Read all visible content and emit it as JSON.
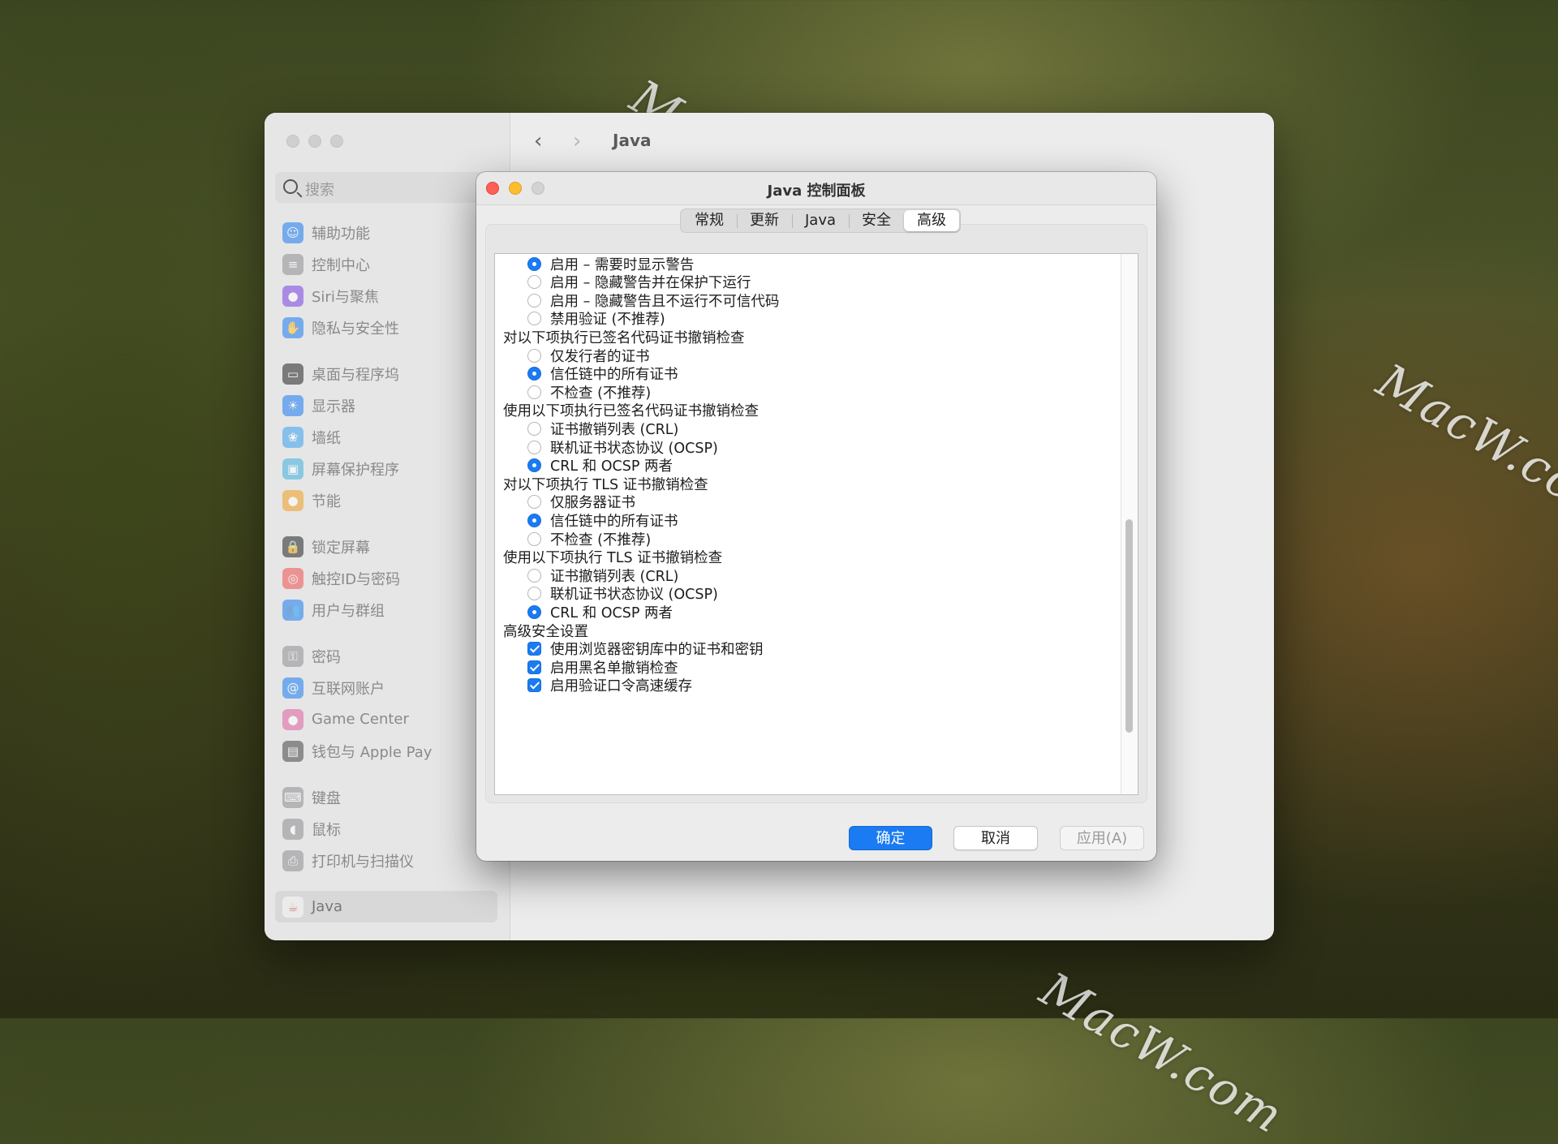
{
  "watermark": "MacW.com",
  "settings": {
    "title": "Java",
    "search_placeholder": "搜索",
    "sidebar": {
      "groups": [
        [
          {
            "label": "辅助功能",
            "icon": "accessibility-icon",
            "color": "#1a7bf2",
            "glyph": "☺"
          },
          {
            "label": "控制中心",
            "icon": "control-center-icon",
            "color": "#8e8e93",
            "glyph": "≡"
          },
          {
            "label": "Siri与聚焦",
            "icon": "siri-icon",
            "color": "#7b3fe4",
            "glyph": "●"
          },
          {
            "label": "隐私与安全性",
            "icon": "hand-icon",
            "color": "#1a7bf2",
            "glyph": "✋"
          }
        ],
        [
          {
            "label": "桌面与程序坞",
            "icon": "desktop-dock-icon",
            "color": "#222222",
            "glyph": "▭"
          },
          {
            "label": "显示器",
            "icon": "display-icon",
            "color": "#1a7bf2",
            "glyph": "☀"
          },
          {
            "label": "墙纸",
            "icon": "wallpaper-icon",
            "color": "#3aa0f0",
            "glyph": "❀"
          },
          {
            "label": "屏幕保护程序",
            "icon": "screensaver-icon",
            "color": "#40b0e0",
            "glyph": "▣"
          },
          {
            "label": "节能",
            "icon": "energy-icon",
            "color": "#f0a020",
            "glyph": "●"
          }
        ],
        [
          {
            "label": "锁定屏幕",
            "icon": "lock-icon",
            "color": "#222222",
            "glyph": "🔒"
          },
          {
            "label": "触控ID与密码",
            "icon": "fingerprint-icon",
            "color": "#f05050",
            "glyph": "◎"
          },
          {
            "label": "用户与群组",
            "icon": "users-icon",
            "color": "#1a7bf2",
            "glyph": "👥"
          }
        ],
        [
          {
            "label": "密码",
            "icon": "key-icon",
            "color": "#8e8e93",
            "glyph": "⚿"
          },
          {
            "label": "互联网账户",
            "icon": "at-icon",
            "color": "#1a7bf2",
            "glyph": "@"
          },
          {
            "label": "Game Center",
            "icon": "game-center-icon",
            "color": "#e060a0",
            "glyph": "●"
          },
          {
            "label": "钱包与 Apple Pay",
            "icon": "wallet-icon",
            "color": "#444444",
            "glyph": "▤"
          }
        ],
        [
          {
            "label": "键盘",
            "icon": "keyboard-icon",
            "color": "#8e8e93",
            "glyph": "⌨"
          },
          {
            "label": "鼠标",
            "icon": "mouse-icon",
            "color": "#8e8e93",
            "glyph": "◖"
          },
          {
            "label": "打印机与扫描仪",
            "icon": "printer-icon",
            "color": "#8e8e93",
            "glyph": "⎙"
          }
        ]
      ],
      "selected": {
        "label": "Java",
        "icon": "java-icon",
        "glyph": "☕"
      }
    }
  },
  "dialog": {
    "title": "Java 控制面板",
    "tabs": [
      {
        "label": "常规",
        "active": false
      },
      {
        "label": "更新",
        "active": false
      },
      {
        "label": "Java",
        "active": false
      },
      {
        "label": "安全",
        "active": false
      },
      {
        "label": "高级",
        "active": true
      }
    ],
    "rows": [
      {
        "type": "radio",
        "checked": true,
        "label": "启用 – 需要时显示警告"
      },
      {
        "type": "radio",
        "checked": false,
        "label": "启用 – 隐藏警告并在保护下运行"
      },
      {
        "type": "radio",
        "checked": false,
        "label": "启用 – 隐藏警告且不运行不可信代码"
      },
      {
        "type": "radio",
        "checked": false,
        "label": "禁用验证 (不推荐)"
      },
      {
        "type": "head",
        "label": "对以下项执行已签名代码证书撤销检查"
      },
      {
        "type": "radio",
        "checked": false,
        "label": "仅发行者的证书"
      },
      {
        "type": "radio",
        "checked": true,
        "label": "信任链中的所有证书"
      },
      {
        "type": "radio",
        "checked": false,
        "label": "不检查 (不推荐)"
      },
      {
        "type": "head",
        "label": "使用以下项执行已签名代码证书撤销检查"
      },
      {
        "type": "radio",
        "checked": false,
        "label": "证书撤销列表 (CRL)"
      },
      {
        "type": "radio",
        "checked": false,
        "label": "联机证书状态协议 (OCSP)"
      },
      {
        "type": "radio",
        "checked": true,
        "label": "CRL 和 OCSP 两者"
      },
      {
        "type": "head",
        "label": "对以下项执行 TLS 证书撤销检查"
      },
      {
        "type": "radio",
        "checked": false,
        "label": "仅服务器证书"
      },
      {
        "type": "radio",
        "checked": true,
        "label": "信任链中的所有证书"
      },
      {
        "type": "radio",
        "checked": false,
        "label": "不检查 (不推荐)"
      },
      {
        "type": "head",
        "label": "使用以下项执行 TLS 证书撤销检查"
      },
      {
        "type": "radio",
        "checked": false,
        "label": "证书撤销列表 (CRL)"
      },
      {
        "type": "radio",
        "checked": false,
        "label": "联机证书状态协议 (OCSP)"
      },
      {
        "type": "radio",
        "checked": true,
        "label": "CRL 和 OCSP 两者"
      },
      {
        "type": "head",
        "label": "高级安全设置"
      },
      {
        "type": "check",
        "checked": true,
        "label": "使用浏览器密钥库中的证书和密钥"
      },
      {
        "type": "check",
        "checked": true,
        "label": "启用黑名单撤销检查"
      },
      {
        "type": "check",
        "checked": true,
        "label": "启用验证口令高速缓存"
      }
    ],
    "buttons": {
      "ok": "确定",
      "cancel": "取消",
      "apply": "应用(A)"
    },
    "accent": "#1a7bf2"
  }
}
